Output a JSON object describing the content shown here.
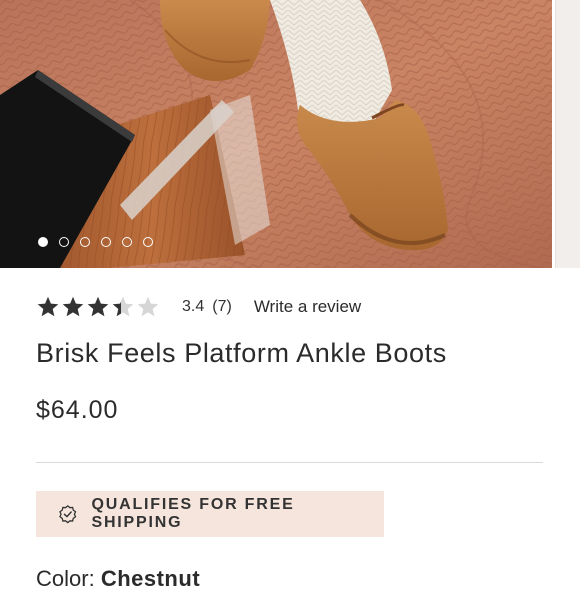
{
  "gallery": {
    "slide_count": 6,
    "active_index": 0
  },
  "product": {
    "rating_value": 3.4,
    "rating_text": "3.4",
    "review_count": "(7)",
    "write_review_label": "Write a review",
    "title": "Brisk Feels Platform Ankle Boots",
    "price": "$64.00"
  },
  "shipping": {
    "label": "QUALIFIES FOR FREE SHIPPING",
    "icon": "badge-check-icon"
  },
  "color": {
    "label": "Color:",
    "value": "Chestnut"
  },
  "colors": {
    "banner_bg": "#f5e5dc",
    "star_fill": "#333333",
    "star_empty": "#d6d6d6"
  }
}
